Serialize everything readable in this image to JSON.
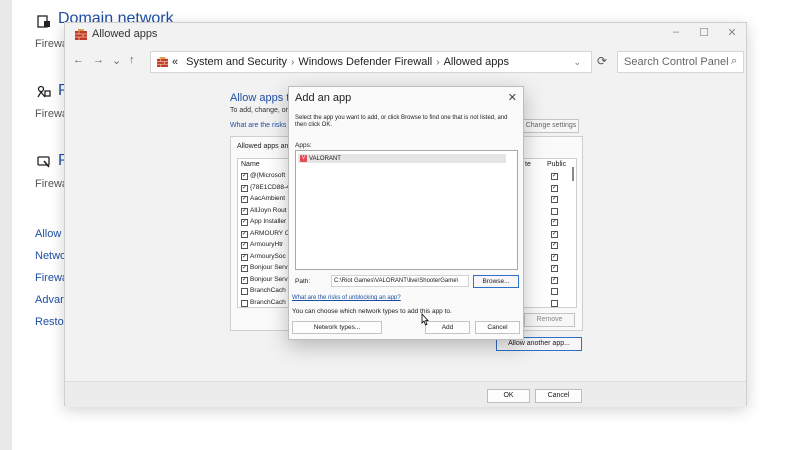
{
  "background": {
    "domain_title": "Domain network",
    "labels": [
      "Firewa",
      "Firewa",
      "Firewa"
    ],
    "heads": [
      "P",
      "P"
    ],
    "left_links": [
      "Allow",
      "Netwo",
      "Firewa",
      "Advar",
      "Restor"
    ]
  },
  "window": {
    "title": "Allowed apps",
    "controls": {
      "minimize": "–",
      "maximize": "☐",
      "close": "✕"
    },
    "nav": {
      "back": "←",
      "forward": "→",
      "recent": "⌄",
      "up": "↑"
    },
    "breadcrumb": {
      "prefix": "«",
      "items": [
        "System and Security",
        "Windows Defender Firewall",
        "Allowed apps"
      ],
      "separator": "›"
    },
    "refresh": "⟳",
    "search_placeholder": "Search Control Panel",
    "search_icon": "⌕"
  },
  "firewall": {
    "title": "Allow apps to",
    "subtitle": "To add, change, or",
    "risk_link": "What are the risks",
    "change_settings": "Change settings",
    "group_title": "Allowed apps an",
    "columns": {
      "name": "Name",
      "private": "te",
      "public": "Public"
    },
    "rows": [
      {
        "name": "@{Microsoft",
        "checked": true,
        "public": true
      },
      {
        "name": "{78E1CD88-4",
        "checked": true,
        "public": true
      },
      {
        "name": "AacAmbient",
        "checked": true,
        "public": true
      },
      {
        "name": "AllJoyn Rout",
        "checked": true,
        "public": false
      },
      {
        "name": "App Installer",
        "checked": true,
        "public": true
      },
      {
        "name": "ARMOURY C",
        "checked": true,
        "public": true
      },
      {
        "name": "ArmouryHtr",
        "checked": true,
        "public": true
      },
      {
        "name": "ArmourySoc",
        "checked": true,
        "public": true
      },
      {
        "name": "Bonjour Serv",
        "checked": true,
        "public": true
      },
      {
        "name": "Bonjour Serv",
        "checked": true,
        "public": true
      },
      {
        "name": "BranchCach",
        "checked": false,
        "public": false
      },
      {
        "name": "BranchCach",
        "checked": false,
        "public": false
      }
    ],
    "remove": "Remove",
    "allow_another": "Allow another app...",
    "ok": "OK",
    "cancel": "Cancel"
  },
  "dialog": {
    "title": "Add an app",
    "close": "✕",
    "description": "Select the app you want to add, or click Browse to find one that is not listed, and then click OK.",
    "apps_label": "Apps:",
    "apps": [
      {
        "name": "VALORANT",
        "selected": true
      }
    ],
    "path_label": "Path:",
    "path_value": "C:\\Riot Games\\VALORANT\\live\\ShooterGame\\",
    "browse": "Browse...",
    "risks_link": "What are the risks of unblocking an app?",
    "choose_text": "You can choose which network types to add this app to.",
    "network_types": "Network types...",
    "add": "Add",
    "cancel": "Cancel"
  }
}
